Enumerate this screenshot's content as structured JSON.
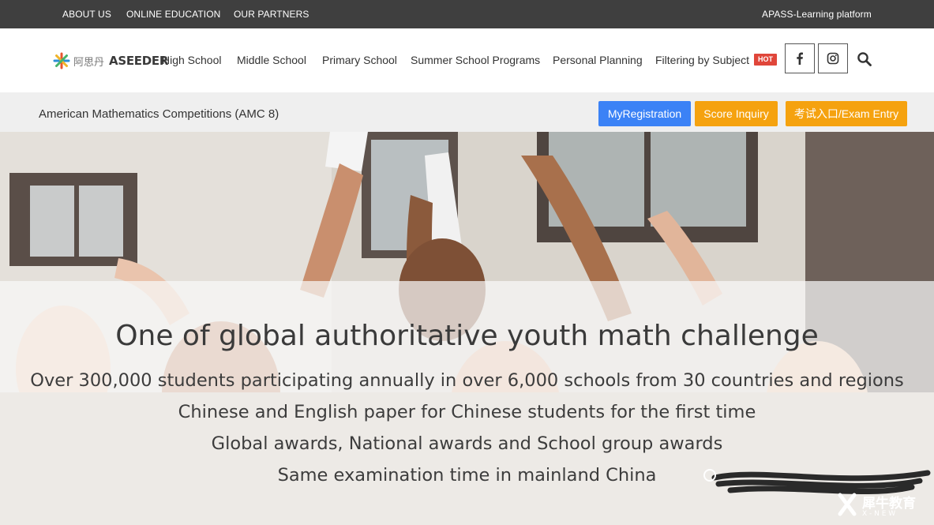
{
  "topbar": {
    "links": [
      "ABOUT US",
      "ONLINE EDUCATION",
      "OUR PARTNERS"
    ],
    "platform": "APASS-Learning platform"
  },
  "nav": {
    "logo_cn": "阿思丹",
    "logo_en": "ASEEDER",
    "items": [
      "High School",
      "Middle School",
      "Primary School",
      "Summer School Programs",
      "Personal Planning",
      "Filtering by Subject"
    ],
    "hot_badge": "HOT",
    "icons": [
      "facebook-icon",
      "instagram-icon",
      "search-icon"
    ]
  },
  "subheader": {
    "title": "American Mathematics Competitions (AMC 8)",
    "buttons": [
      "MyRegistration",
      "Score Inquiry",
      "考试入口/Exam Entry"
    ]
  },
  "hero": {
    "headline": "One of global authoritative youth math challenge",
    "lines": [
      "Over 300,000 students participating annually in over 6,000 schools from 30 countries and regions",
      "Chinese and English paper for Chinese students for the first time",
      "Global awards, National awards and School group awards",
      "Same examination time in mainland China"
    ],
    "watermark": "犀牛教育",
    "watermark_sub": "X - N E W"
  },
  "colors": {
    "topbar": "#3f3f3f",
    "button_blue": "#3b82f6",
    "button_orange": "#f5a20f",
    "hot": "#e0463a"
  }
}
